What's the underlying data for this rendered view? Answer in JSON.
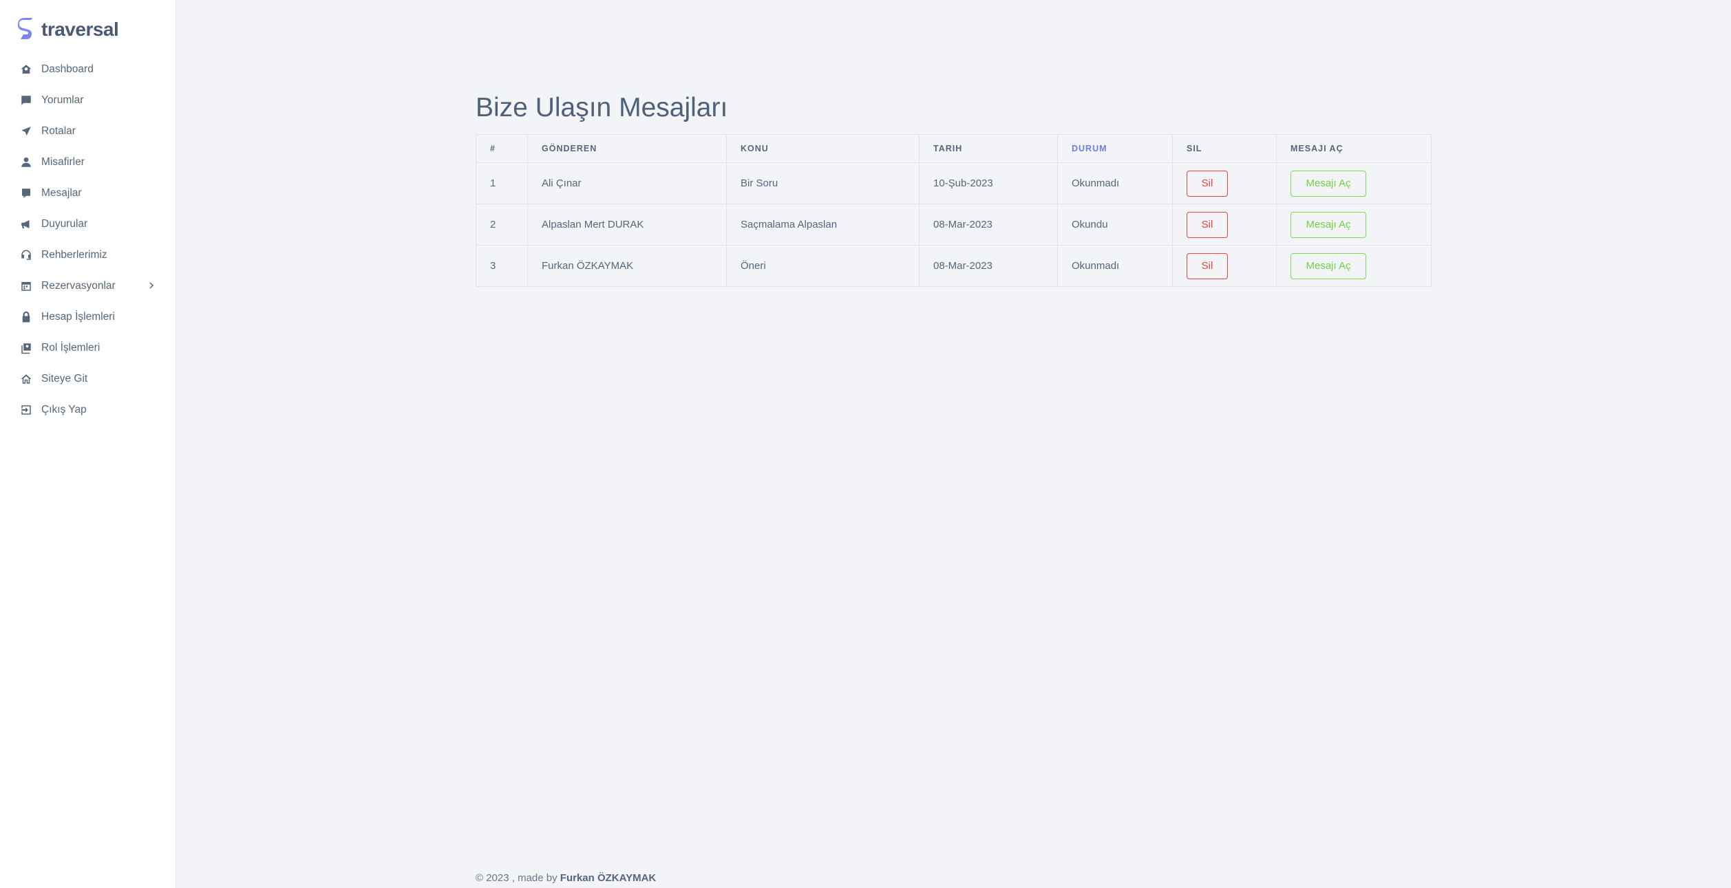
{
  "brand": {
    "name": "traversal",
    "accent": "#7b86f5"
  },
  "sidebar": {
    "items": [
      {
        "label": "Dashboard",
        "icon": "dashboard-icon"
      },
      {
        "label": "Yorumlar",
        "icon": "comment-icon"
      },
      {
        "label": "Rotalar",
        "icon": "plane-icon"
      },
      {
        "label": "Misafirler",
        "icon": "user-icon"
      },
      {
        "label": "Mesajlar",
        "icon": "message-icon"
      },
      {
        "label": "Duyurular",
        "icon": "megaphone-icon"
      },
      {
        "label": "Rehberlerimiz",
        "icon": "headset-icon"
      },
      {
        "label": "Rezervasyonlar",
        "icon": "calendar-icon",
        "has_submenu": true
      },
      {
        "label": "Hesap İşlemleri",
        "icon": "lock-icon"
      },
      {
        "label": "Rol İşlemleri",
        "icon": "role-icon"
      },
      {
        "label": "Siteye Git",
        "icon": "home-icon"
      },
      {
        "label": "Çıkış Yap",
        "icon": "logout-icon"
      }
    ]
  },
  "page": {
    "title": "Bize Ulaşın Mesajları"
  },
  "table": {
    "headers": {
      "index": "#",
      "sender": "GÖNDEREN",
      "subject": "KONU",
      "date": "TARIH",
      "status": "DURUM",
      "delete": "SIL",
      "open": "MESAJI AÇ"
    },
    "rows": [
      {
        "index": "1",
        "sender": "Ali Çınar",
        "subject": "Bir Soru",
        "date": "10-Şub-2023",
        "status": "Okunmadı",
        "delete": "Sil",
        "open": "Mesajı Aç"
      },
      {
        "index": "2",
        "sender": "Alpaslan Mert DURAK",
        "subject": "Saçmalama Alpaslan",
        "date": "08-Mar-2023",
        "status": "Okundu",
        "delete": "Sil",
        "open": "Mesajı Aç"
      },
      {
        "index": "3",
        "sender": "Furkan ÖZKAYMAK",
        "subject": "Öneri",
        "date": "08-Mar-2023",
        "status": "Okunmadı",
        "delete": "Sil",
        "open": "Mesajı Aç"
      }
    ]
  },
  "footer": {
    "prefix": "© 2023 , made by",
    "author": "Furkan ÖZKAYMAK"
  },
  "colors": {
    "delete": "#e6453a",
    "open": "#6fd43c",
    "sorted_header": "#6f7ce8"
  }
}
